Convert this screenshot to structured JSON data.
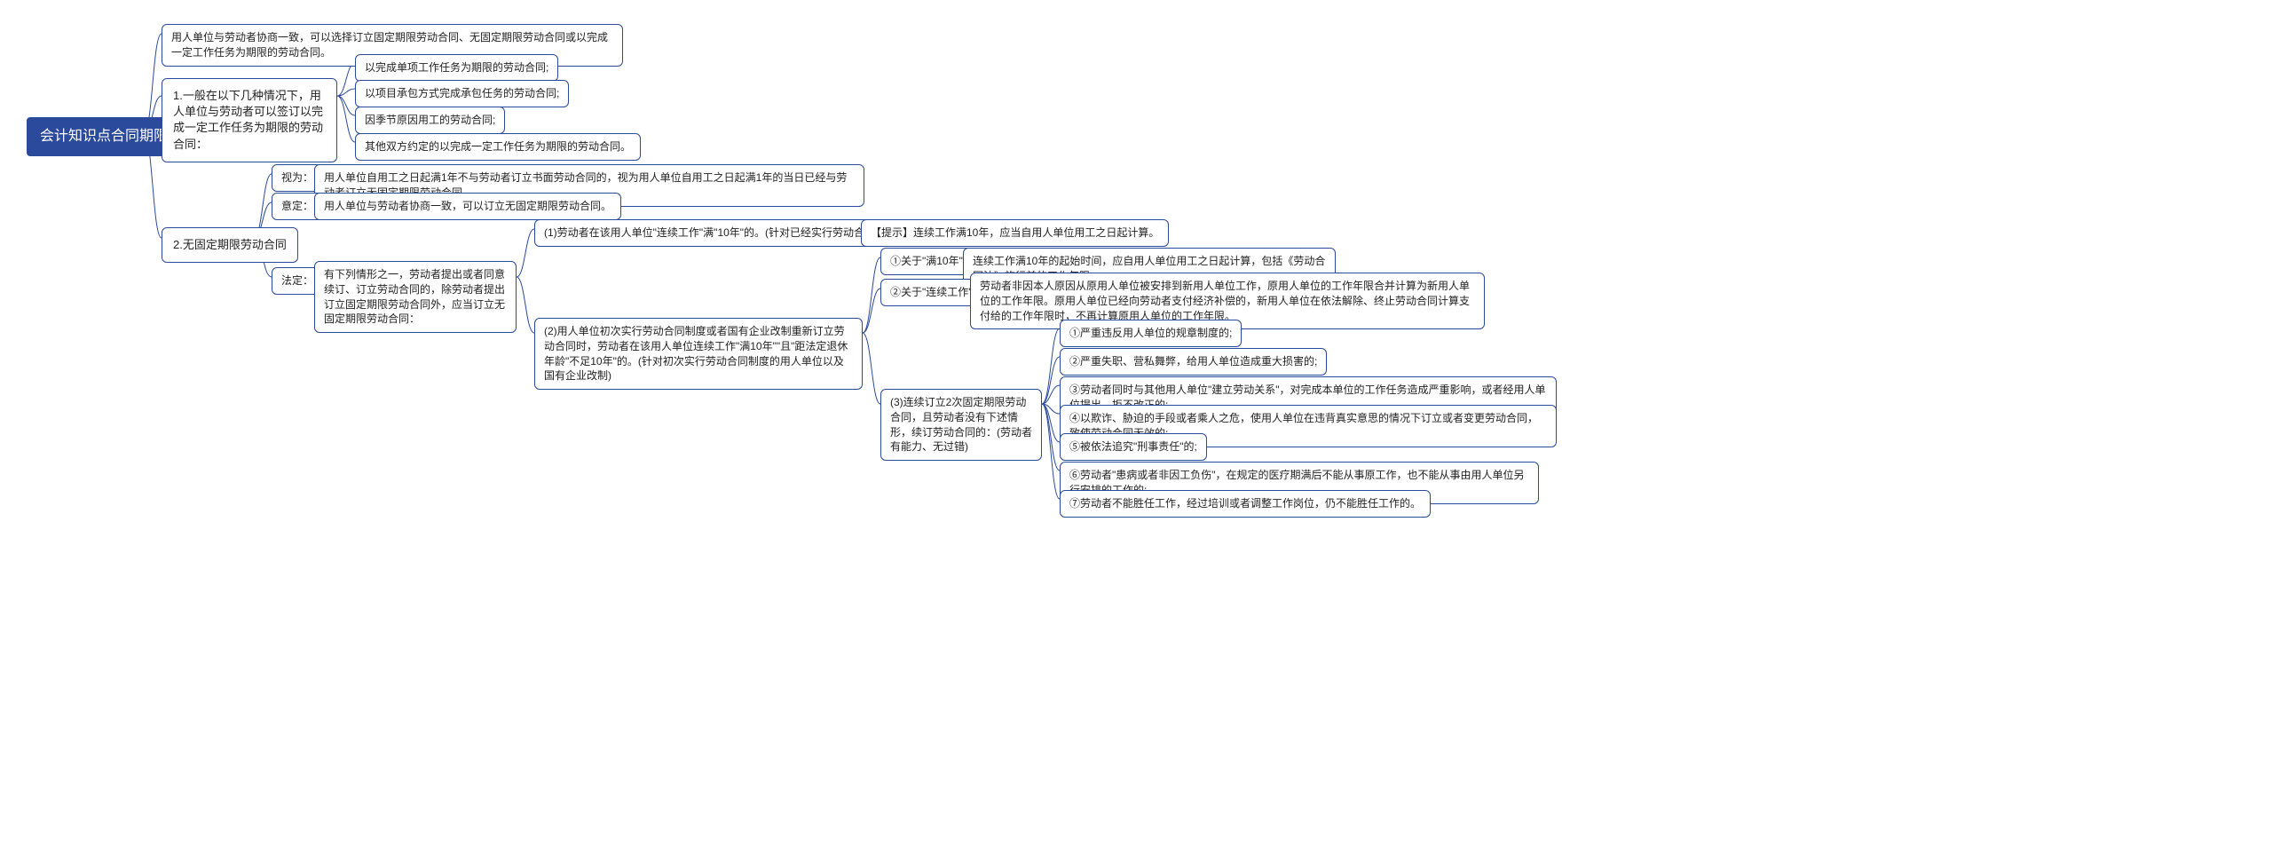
{
  "root": "会计知识点合同期限",
  "b1_intro": "用人单位与劳动者协商一致，可以选择订立固定期限劳动合同、无固定期限劳动合同或以完成一定工作任务为期限的劳动合同。",
  "b1_title": "1.一般在以下几种情况下，用人单位与劳动者可以签订以完成一定工作任务为期限的劳动合同：",
  "b1_c1": "以完成单项工作任务为期限的劳动合同;",
  "b1_c2": "以项目承包方式完成承包任务的劳动合同;",
  "b1_c3": "因季节原因用工的劳动合同;",
  "b1_c4": "其他双方约定的以完成一定工作任务为期限的劳动合同。",
  "b2_title": "2.无固定期限劳动合同",
  "b2_shiwei_label": "视为：",
  "b2_shiwei_text": "用人单位自用工之日起满1年不与劳动者订立书面劳动合同的，视为用人单位自用工之日起满1年的当日已经与劳动者订立无固定期限劳动合同。",
  "b2_yueding_label": "意定：",
  "b2_yueding_text": "用人单位与劳动者协商一致，可以订立无固定期限劳动合同。",
  "b2_fading_label": "法定：",
  "b2_fading_text": "有下列情形之一，劳动者提出或者同意续订、订立劳动合同的，除劳动者提出订立固定期限劳动合同外，应当订立无固定期限劳动合同：",
  "fd1": "(1)劳动者在该用人单位\"连续工作\"满\"10年\"的。(针对已经实行劳动合同制的用人单位)",
  "fd1_tip": "【提示】连续工作满10年，应当自用人单位用工之日起计算。",
  "fd2": "(2)用人单位初次实行劳动合同制度或者国有企业改制重新订立劳动合同时，劳动者在该用人单位连续工作\"满10年\"\"且\"距法定退休年龄\"不足10年\"的。(针对初次实行劳动合同制度的用人单位以及国有企业改制)",
  "fd2_a_label": "①关于\"满10年\"：",
  "fd2_a_text": "连续工作满10年的起始时间，应自用人单位用工之日起计算，包括《劳动合同法》施行前的工作年限。",
  "fd2_b_label": "②关于\"连续工作\"：",
  "fd2_b_text": "劳动者非因本人原因从原用人单位被安排到新用人单位工作，原用人单位的工作年限合并计算为新用人单位的工作年限。原用人单位已经向劳动者支付经济补偿的，新用人单位在依法解除、终止劳动合同计算支付给的工作年限时，不再计算原用人单位的工作年限。",
  "fd3": "(3)连续订立2次固定期限劳动合同，且劳动者没有下述情形，续订劳动合同的：(劳动者有能力、无过错)",
  "fd3_1": "①严重违反用人单位的规章制度的;",
  "fd3_2": "②严重失职、营私舞弊，给用人单位造成重大损害的;",
  "fd3_3": "③劳动者同时与其他用人单位\"建立劳动关系\"，对完成本单位的工作任务造成严重影响，或者经用人单位提出，拒不改正的;",
  "fd3_4": "④以欺诈、胁迫的手段或者乘人之危，使用人单位在违背真实意思的情况下订立或者变更劳动合同，致使劳动合同无效的;",
  "fd3_5": "⑤被依法追究\"刑事责任\"的;",
  "fd3_6": "⑥劳动者\"患病或者非因工负伤\"，在规定的医疗期满后不能从事原工作，也不能从事由用人单位另行安排的工作的;",
  "fd3_7": "⑦劳动者不能胜任工作，经过培训或者调整工作岗位，仍不能胜任工作的。"
}
